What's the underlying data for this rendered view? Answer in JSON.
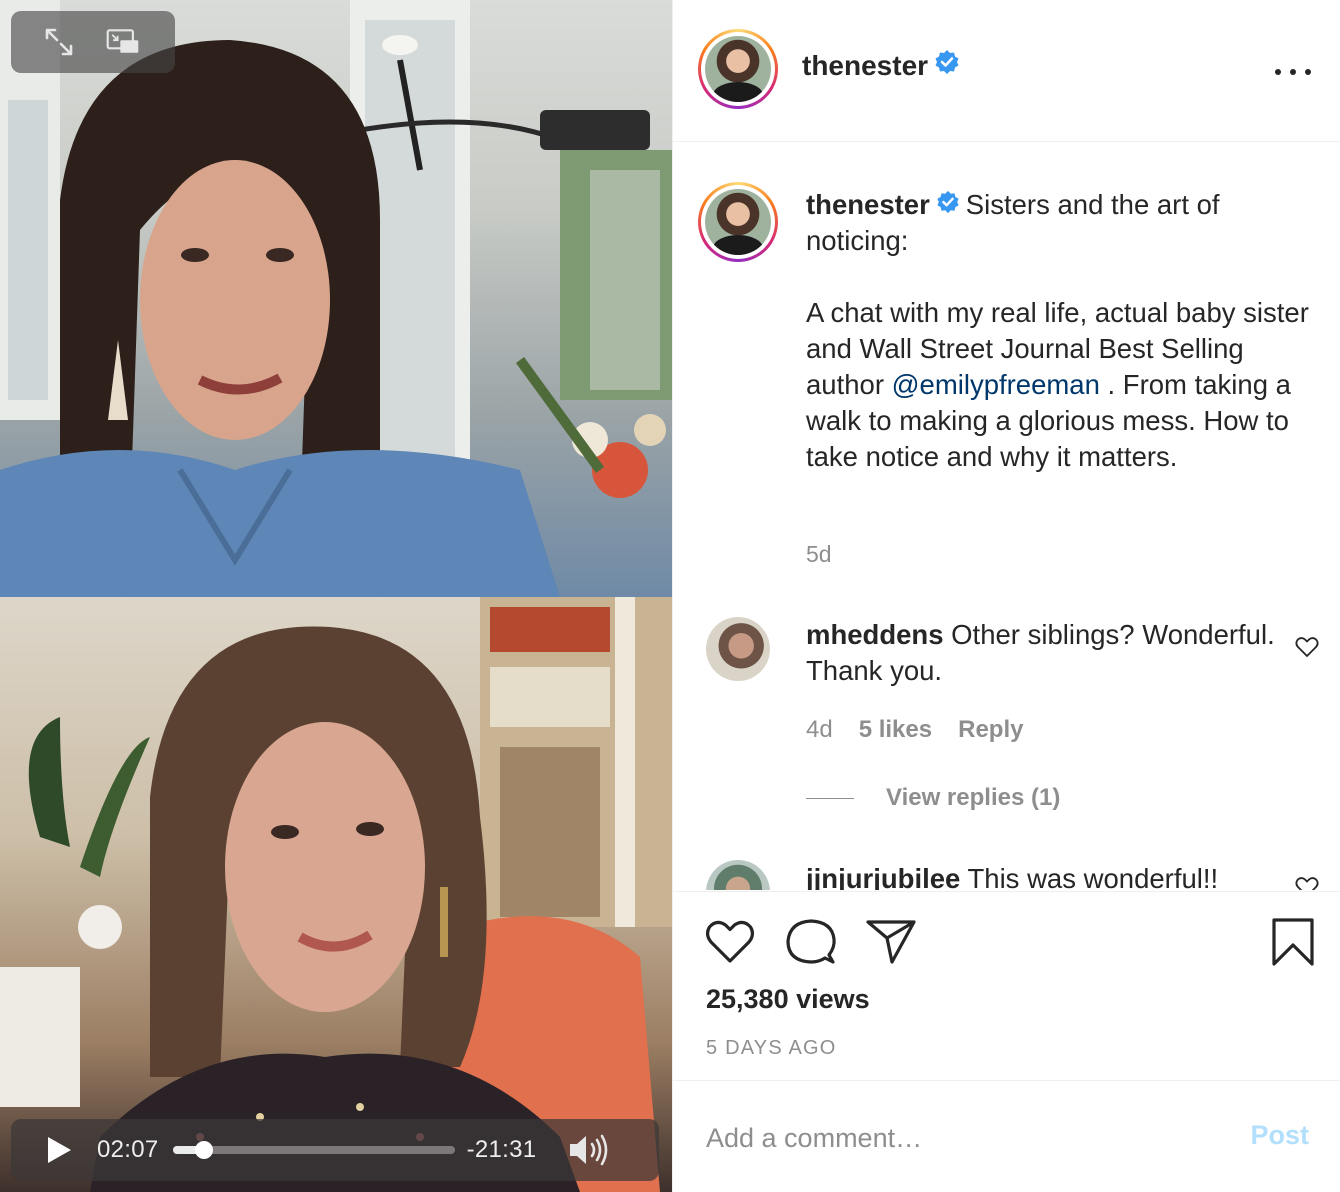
{
  "video": {
    "controls": {
      "fullscreen_icon": "expand-arrows-icon",
      "pip_icon": "picture-in-picture-icon"
    },
    "player": {
      "play_icon": "play-icon",
      "elapsed": "02:07",
      "remaining": "-21:31",
      "progress": 0.11,
      "volume_icon": "speaker-icon"
    }
  },
  "header": {
    "username": "thenester",
    "verified": true,
    "more_icon": "more-options-icon"
  },
  "caption": {
    "username": "thenester",
    "line1": "Sisters and the art of noticing:",
    "para2_before": "A chat with my real life, actual baby sister and Wall Street Journal Best Selling author",
    "mention": "@emilypfreeman",
    "para2_after": " . From taking a walk to making a glorious mess. How to take notice and why it matters.",
    "age": "5d"
  },
  "comments": [
    {
      "username": "mheddens",
      "text": "Other siblings? Wonderful. Thank you.",
      "age": "4d",
      "likes": "5 likes",
      "reply_label": "Reply",
      "view_replies": "View replies (1)"
    },
    {
      "username": "jjnjurjubilee",
      "text": "This was wonderful!!"
    }
  ],
  "actions": {
    "views": "25,380 views",
    "date": "5 DAYS AGO"
  },
  "comment_box": {
    "placeholder": "Add a comment…",
    "post_label": "Post"
  },
  "colors": {
    "mention": "#00376b",
    "verified": "#3897f0",
    "post_disabled": "#b2dffc",
    "muted": "#8e8e8e"
  }
}
